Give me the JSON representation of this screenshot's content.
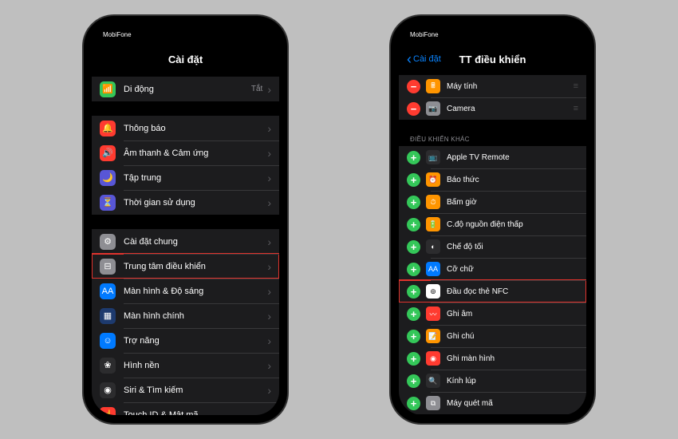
{
  "phone1": {
    "carrier": "MobiFone",
    "title": "Cài đặt",
    "groups": [
      {
        "rows": [
          {
            "icon_bg": "bg-green",
            "icon_glyph": "📶",
            "label": "Di động",
            "status": "Tắt",
            "chevron": true,
            "name": "row-mobile"
          }
        ]
      },
      {
        "rows": [
          {
            "icon_bg": "bg-red",
            "icon_glyph": "🔔",
            "label": "Thông báo",
            "chevron": true,
            "name": "row-notifications"
          },
          {
            "icon_bg": "bg-red",
            "icon_glyph": "🔊",
            "label": "Âm thanh & Cảm ứng",
            "chevron": true,
            "name": "row-sounds"
          },
          {
            "icon_bg": "bg-purple",
            "icon_glyph": "🌙",
            "label": "Tập trung",
            "chevron": true,
            "name": "row-focus"
          },
          {
            "icon_bg": "bg-purple",
            "icon_glyph": "⏳",
            "label": "Thời gian sử dụng",
            "chevron": true,
            "name": "row-screentime"
          }
        ]
      },
      {
        "rows": [
          {
            "icon_bg": "bg-gray",
            "icon_glyph": "⚙",
            "label": "Cài đặt chung",
            "chevron": true,
            "name": "row-general"
          },
          {
            "icon_bg": "bg-gray",
            "icon_glyph": "⊟",
            "label": "Trung tâm điều khiển",
            "chevron": true,
            "name": "row-control-center",
            "highlight": true
          },
          {
            "icon_bg": "bg-blue",
            "icon_glyph": "AA",
            "label": "Màn hình & Độ sáng",
            "chevron": true,
            "name": "row-display"
          },
          {
            "icon_bg": "bg-darkblue",
            "icon_glyph": "▦",
            "label": "Màn hình chính",
            "chevron": true,
            "name": "row-home"
          },
          {
            "icon_bg": "bg-blue",
            "icon_glyph": "☺",
            "label": "Trợ năng",
            "chevron": true,
            "name": "row-accessibility"
          },
          {
            "icon_bg": "bg-black",
            "icon_glyph": "❀",
            "label": "Hình nền",
            "chevron": true,
            "name": "row-wallpaper"
          },
          {
            "icon_bg": "bg-black",
            "icon_glyph": "◉",
            "label": "Siri & Tìm kiếm",
            "chevron": true,
            "name": "row-siri"
          },
          {
            "icon_bg": "bg-red",
            "icon_glyph": "☝",
            "label": "Touch ID & Mật mã",
            "chevron": true,
            "name": "row-touchid"
          }
        ]
      }
    ]
  },
  "phone2": {
    "carrier": "MobiFone",
    "back": "Cài đặt",
    "title": "TT điều khiển",
    "included": [
      {
        "btn": "remove",
        "icon_bg": "bg-orange",
        "icon_glyph": "🖩",
        "label": "Máy tính",
        "name": "row-calculator"
      },
      {
        "btn": "remove",
        "icon_bg": "bg-gray",
        "icon_glyph": "📷",
        "label": "Camera",
        "name": "row-camera"
      }
    ],
    "more_header": "ĐIỀU KHIỂN KHÁC",
    "more": [
      {
        "icon_bg": "bg-black",
        "icon_glyph": "📺",
        "label": "Apple TV Remote",
        "name": "row-apple-tv"
      },
      {
        "icon_bg": "bg-orange",
        "icon_glyph": "⏰",
        "label": "Báo thức",
        "name": "row-alarm"
      },
      {
        "icon_bg": "bg-orange",
        "icon_glyph": "⏱",
        "label": "Bấm giờ",
        "name": "row-stopwatch"
      },
      {
        "icon_bg": "bg-orange",
        "icon_glyph": "🔋",
        "label": "C.độ nguồn điện thấp",
        "name": "row-low-power"
      },
      {
        "icon_bg": "bg-black",
        "icon_glyph": "◐",
        "label": "Chế độ tối",
        "name": "row-dark-mode"
      },
      {
        "icon_bg": "bg-blue",
        "icon_glyph": "AA",
        "label": "Cỡ chữ",
        "name": "row-text-size"
      },
      {
        "icon_bg": "bg-white",
        "icon_glyph": "⊚",
        "label": "Đầu đọc thẻ NFC",
        "name": "row-nfc",
        "highlight": true
      },
      {
        "icon_bg": "bg-red",
        "icon_glyph": "〰",
        "label": "Ghi âm",
        "name": "row-voice-memo"
      },
      {
        "icon_bg": "bg-orange",
        "icon_glyph": "📝",
        "label": "Ghi chú",
        "name": "row-notes"
      },
      {
        "icon_bg": "bg-red",
        "icon_glyph": "◉",
        "label": "Ghi màn hình",
        "name": "row-screen-record"
      },
      {
        "icon_bg": "bg-black",
        "icon_glyph": "🔍",
        "label": "Kính lúp",
        "name": "row-magnifier"
      },
      {
        "icon_bg": "bg-gray",
        "icon_glyph": "⧉",
        "label": "Máy quét mã",
        "name": "row-code-scanner"
      }
    ]
  }
}
